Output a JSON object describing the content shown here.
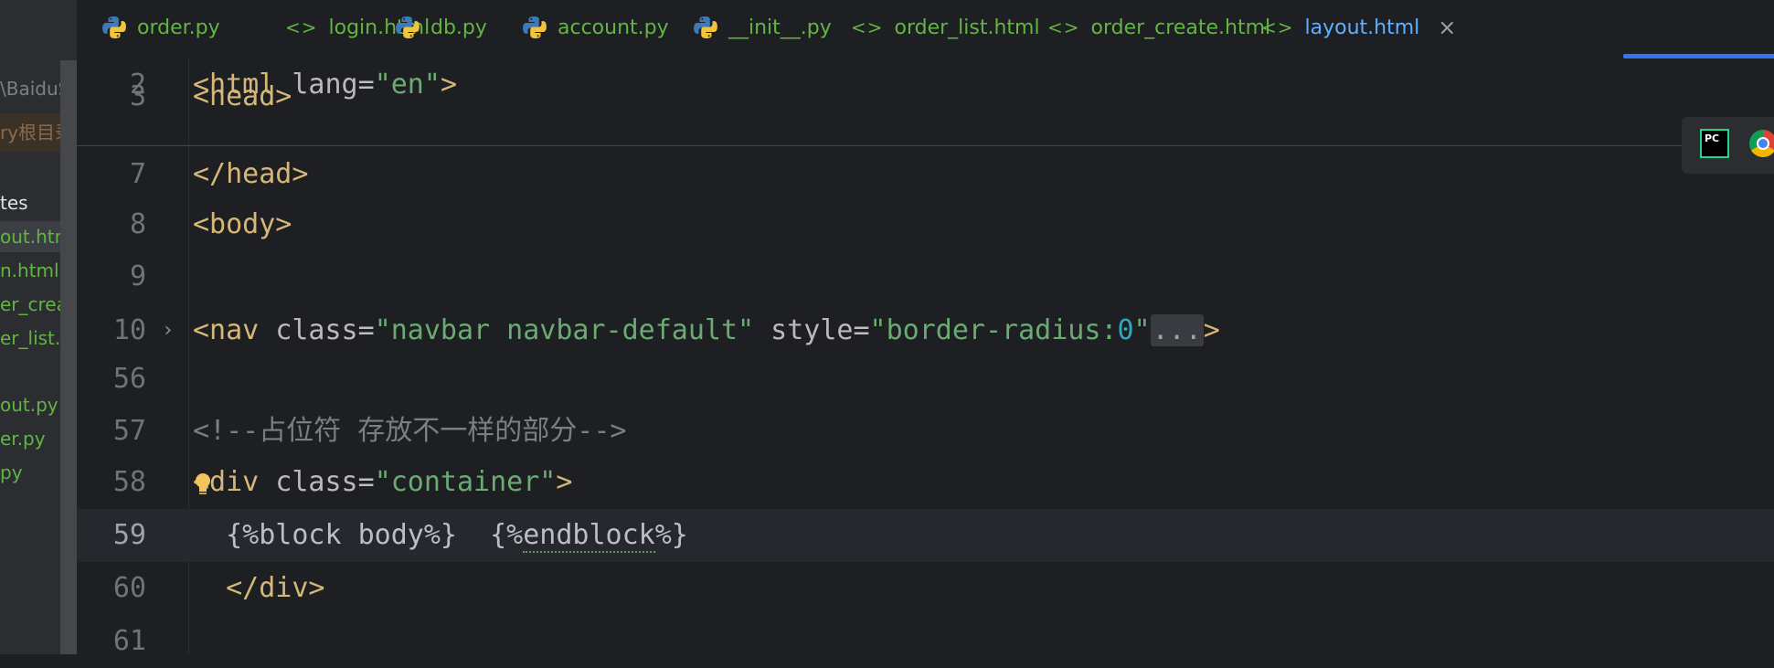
{
  "sidebar": {
    "path_fragment": "\\BaiduSy",
    "root_label": "ry根目录",
    "folder": "tes",
    "files": [
      {
        "label": "out.html",
        "selected": true
      },
      {
        "label": "n.html"
      },
      {
        "label": "er_create"
      },
      {
        "label": "er_list.htm"
      },
      {
        "label": "out.py"
      },
      {
        "label": "er.py"
      },
      {
        "label": "py"
      }
    ]
  },
  "tabs": [
    {
      "label": "order.py",
      "icon": "python-file-icon"
    },
    {
      "label": "login.html",
      "icon": "html-file-icon"
    },
    {
      "label": "db.py",
      "icon": "python-file-icon"
    },
    {
      "label": "account.py",
      "icon": "python-file-icon"
    },
    {
      "label": "__init__.py",
      "icon": "python-file-icon"
    },
    {
      "label": "order_list.html",
      "icon": "html-file-icon"
    },
    {
      "label": "order_create.html",
      "icon": "html-file-icon"
    },
    {
      "label": "layout.html",
      "icon": "html-file-icon",
      "active": true
    }
  ],
  "tab_close": "×",
  "html_icon_glyph": "<>",
  "editor": {
    "lines": [
      {
        "num": "2",
        "parts": [
          [
            "tag",
            "<html "
          ],
          [
            "attr",
            "lang"
          ],
          [
            "plain",
            "="
          ],
          [
            "str",
            "\"en\""
          ],
          [
            "tag",
            ">"
          ]
        ]
      },
      {
        "num": "3",
        "parts": [
          [
            "tag",
            "<head>"
          ]
        ]
      },
      {
        "num": "7",
        "parts": [
          [
            "tag",
            "</head>"
          ]
        ]
      },
      {
        "num": "8",
        "parts": [
          [
            "tag",
            "<body>"
          ]
        ]
      },
      {
        "num": "9",
        "parts": []
      },
      {
        "num": "10",
        "parts": [
          [
            "tag",
            "<nav "
          ],
          [
            "attr",
            "class"
          ],
          [
            "plain",
            "="
          ],
          [
            "str",
            "\"navbar navbar-default\""
          ],
          [
            "attr",
            " style"
          ],
          [
            "plain",
            "="
          ],
          [
            "str",
            "\"border-radius:"
          ],
          [
            "num-lit",
            "0"
          ],
          [
            "str",
            "\""
          ],
          [
            "collapsed",
            "..."
          ],
          [
            "tag",
            ">"
          ]
        ]
      },
      {
        "num": "56",
        "parts": []
      },
      {
        "num": "57",
        "parts": [
          [
            "cmt",
            "<!--占位符 存放不一样的部分-->"
          ]
        ]
      },
      {
        "num": "58",
        "parts": [
          [
            "tag",
            "<div "
          ],
          [
            "attr",
            "class"
          ],
          [
            "plain",
            "="
          ],
          [
            "str",
            "\"container\""
          ],
          [
            "tag",
            ">"
          ]
        ]
      },
      {
        "num": "59",
        "parts": [
          [
            "plain",
            "  {%block body%}  {%"
          ],
          [
            "squiggle",
            "endblock"
          ],
          [
            "plain",
            "%}"
          ]
        ]
      },
      {
        "num": "60",
        "parts": [
          [
            "tag",
            "  </div>"
          ]
        ]
      },
      {
        "num": "61",
        "parts": []
      }
    ]
  },
  "toolbar_icons": [
    "pycharm-icon",
    "chrome-icon"
  ],
  "pycharm_label": "PC"
}
